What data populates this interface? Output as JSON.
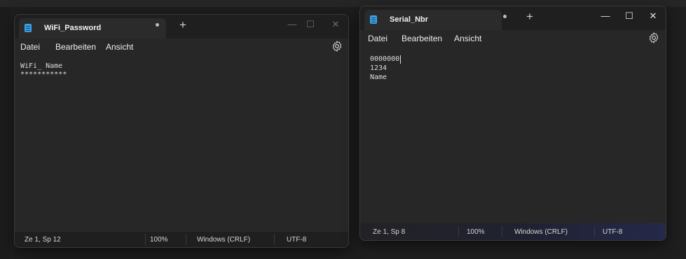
{
  "left_window": {
    "tab_title": "WiFi_Password",
    "unsaved_marker": "●",
    "new_tab_label": "+",
    "controls": {
      "minimize": "—",
      "maximize": "☐",
      "close": "✕"
    },
    "menu": [
      "Datei",
      "Bearbeiten",
      "Ansicht"
    ],
    "settings_icon": "gear-icon",
    "lines": [
      "WiFi_ Name",
      "***********"
    ],
    "status": {
      "position": "Ze 1, Sp 12",
      "zoom": "100%",
      "line_ending": "Windows (CRLF)",
      "encoding": "UTF-8"
    }
  },
  "right_window": {
    "tab_title": "Serial_Nbr",
    "unsaved_marker": "●",
    "new_tab_label": "+",
    "controls": {
      "minimize": "—",
      "maximize": "☐",
      "close": "✕"
    },
    "menu": [
      "Datei",
      "Bearbeiten",
      "Ansicht"
    ],
    "settings_icon": "gear-icon",
    "lines": [
      "0000000",
      "1234",
      "Name"
    ],
    "status": {
      "position": "Ze 1, Sp 8",
      "zoom": "100%",
      "line_ending": "Windows (CRLF)",
      "encoding": "UTF-8"
    }
  },
  "colors": {
    "accent_icon": "#3aa3e8",
    "window_bg": "#272727",
    "titlebar_bg": "#1f1f1f"
  }
}
